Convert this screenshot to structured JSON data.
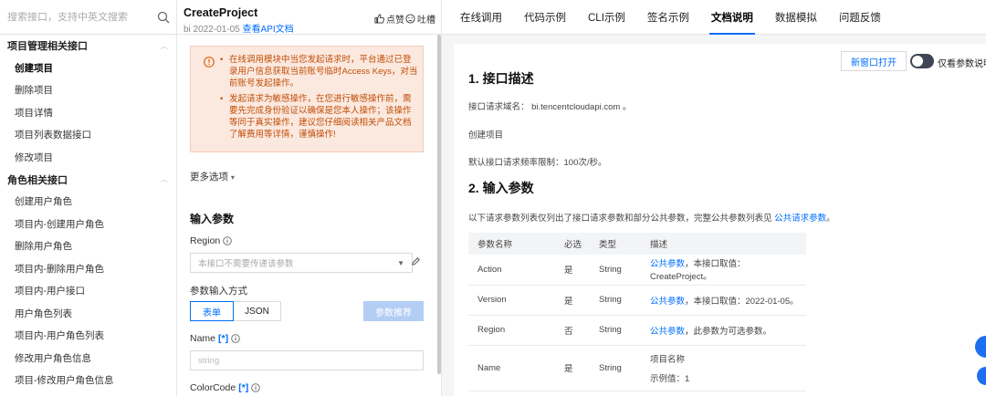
{
  "search": {
    "placeholder": "搜索接口，支持中英文搜索"
  },
  "sidebar": {
    "groups": [
      {
        "label": "项目管理相关接口",
        "items": [
          "创建项目",
          "删除项目",
          "项目详情",
          "项目列表数据接口",
          "修改项目"
        ]
      },
      {
        "label": "角色相关接口",
        "items": [
          "创建用户角色",
          "项目内-创建用户角色",
          "删除用户角色",
          "项目内-删除用户角色",
          "项目内-用户接口",
          "用户角色列表",
          "项目内-用户角色列表",
          "修改用户角色信息",
          "项目-修改用户角色信息"
        ]
      }
    ],
    "active": "创建项目"
  },
  "api": {
    "title": "CreateProject",
    "sub_prefix": "bi 2022-01-05",
    "doc_link": "查看API文档",
    "like": "点赞",
    "dislike": "吐槽"
  },
  "warning": {
    "items": [
      "在线调用模块中当您发起请求时，平台通过已登录用户信息获取当前账号临时Access Keys，对当前账号发起操作。",
      "发起请求为敏感操作，在您进行敏感操作前，需要先完成身份验证以确保是您本人操作；该操作等同于真实操作，建议您仔细阅读相关产品文档了解费用等详情，谨慎操作!"
    ]
  },
  "form": {
    "more_options": "更多选项",
    "section_title": "输入参数",
    "region_label": "Region",
    "region_placeholder": "本接口不需要传递该参数",
    "input_mode_label": "参数输入方式",
    "mode_form": "表单",
    "mode_json": "JSON",
    "recommend": "参数推荐",
    "name_label": "Name",
    "name_required": "[*]",
    "name_placeholder": "string",
    "color_label": "ColorCode",
    "color_required": "[*]"
  },
  "tabs": [
    "在线调用",
    "代码示例",
    "CLI示例",
    "签名示例",
    "文档说明",
    "数据模拟",
    "问题反馈"
  ],
  "active_tab": "文档说明",
  "doc": {
    "new_window": "新窗口打开",
    "only_params": "仅看参数说明",
    "h1": "1. 接口描述",
    "domain": "接口请求域名： bi.tencentcloudapi.com 。",
    "desc": "创建项目",
    "rate": "默认接口请求频率限制：100次/秒。",
    "h2": "2. 输入参数",
    "intro": "以下请求参数列表仅列出了接口请求参数和部分公共参数，完整公共参数列表见",
    "intro_link": "公共请求参数",
    "intro_end": "。",
    "headers": [
      "参数名称",
      "必选",
      "类型",
      "描述"
    ],
    "rows": [
      {
        "name": "Action",
        "req": "是",
        "type": "String",
        "link": "公共参数",
        "desc": "，本接口取值：CreateProject。"
      },
      {
        "name": "Version",
        "req": "是",
        "type": "String",
        "link": "公共参数",
        "desc": "，本接口取值：2022-01-05。"
      },
      {
        "name": "Region",
        "req": "否",
        "type": "String",
        "link": "公共参数",
        "desc": "，此参数为可选参数。"
      },
      {
        "name": "Name",
        "req": "是",
        "type": "String",
        "line1": "项目名称",
        "line2": "示例值：1"
      }
    ]
  },
  "colors": {
    "accent": "#006eff",
    "warn_bg": "#fbe9df",
    "warn_text": "#c14d06"
  }
}
